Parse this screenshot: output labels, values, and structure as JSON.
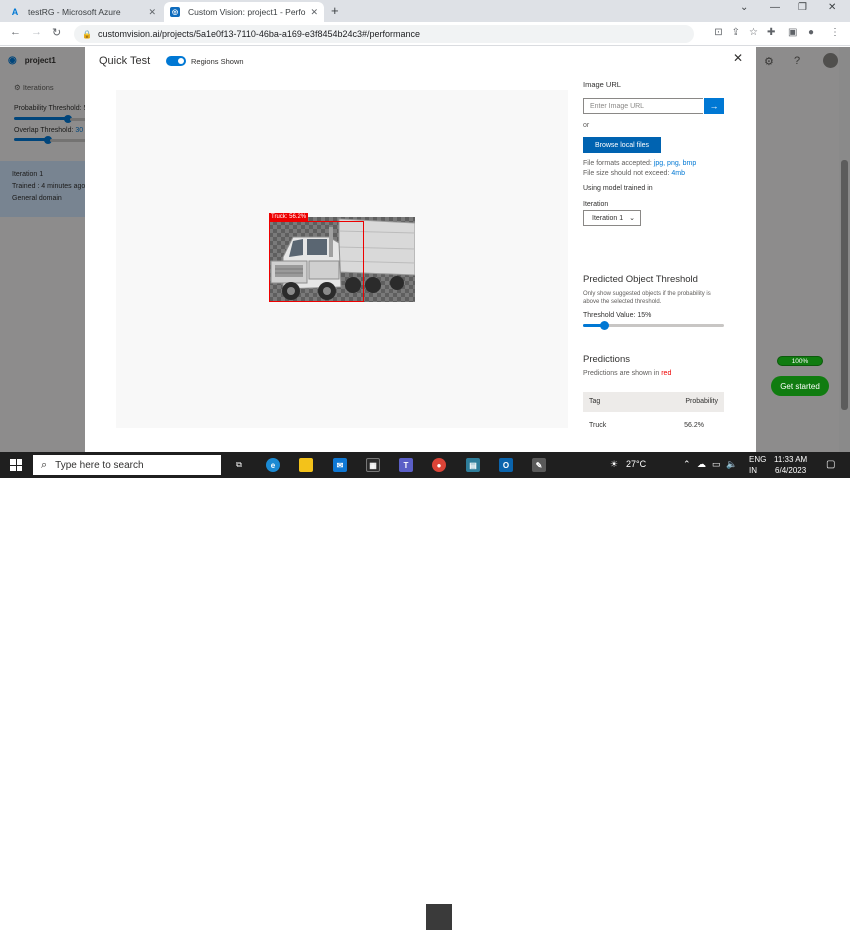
{
  "browser": {
    "tabs": [
      {
        "title": "testRG - Microsoft Azure",
        "active": false
      },
      {
        "title": "Custom Vision: project1 - Perfor",
        "active": true
      }
    ],
    "url": "customvision.ai/projects/5a1e0f13-7110-46ba-a169-e3f8454b24c3#/performance"
  },
  "background": {
    "project_name": "project1",
    "iterations_label": "Iterations",
    "probability_threshold_label": "Probability Threshold: 5",
    "overlap_threshold_label": "Overlap Threshold:",
    "overlap_threshold_value": "30",
    "iteration_card": {
      "name": "Iteration 1",
      "trained": "Trained : 4 minutes ago",
      "domain": "General domain"
    },
    "progress_label": "100%",
    "get_started_label": "Get started"
  },
  "modal": {
    "title": "Quick Test",
    "regions_toggle_label": "Regions Shown",
    "prediction_box_label": "Truck: 56.2%",
    "image_url_label": "Image URL",
    "image_url_placeholder": "Enter Image URL",
    "or_label": "or",
    "browse_button": "Browse local files",
    "formats_prefix": "File formats accepted:",
    "formats_value": "jpg, png, bmp",
    "size_prefix": "File size should not exceed:",
    "size_value": "4mb",
    "using_model_label": "Using model trained in",
    "iteration_label": "Iteration",
    "iteration_selected": "Iteration 1",
    "threshold_section_title": "Predicted Object Threshold",
    "threshold_description": "Only show suggested objects if the probability is above the selected threshold.",
    "threshold_value_label": "Threshold Value: 15%",
    "threshold_value": 0.15,
    "predictions_title": "Predictions",
    "predictions_note_prefix": "Predictions are shown in",
    "predictions_note_color_word": "red",
    "table": {
      "headers": [
        "Tag",
        "Probability"
      ],
      "rows": [
        [
          "Truck",
          "56.2%"
        ]
      ]
    },
    "accent_color": "#0078d4",
    "prediction_color": "#e00000"
  },
  "taskbar": {
    "search_placeholder": "Type here to search",
    "weather": "27°C",
    "language": "ENG",
    "region": "IN",
    "time": "11:33 AM",
    "date": "6/4/2023"
  }
}
